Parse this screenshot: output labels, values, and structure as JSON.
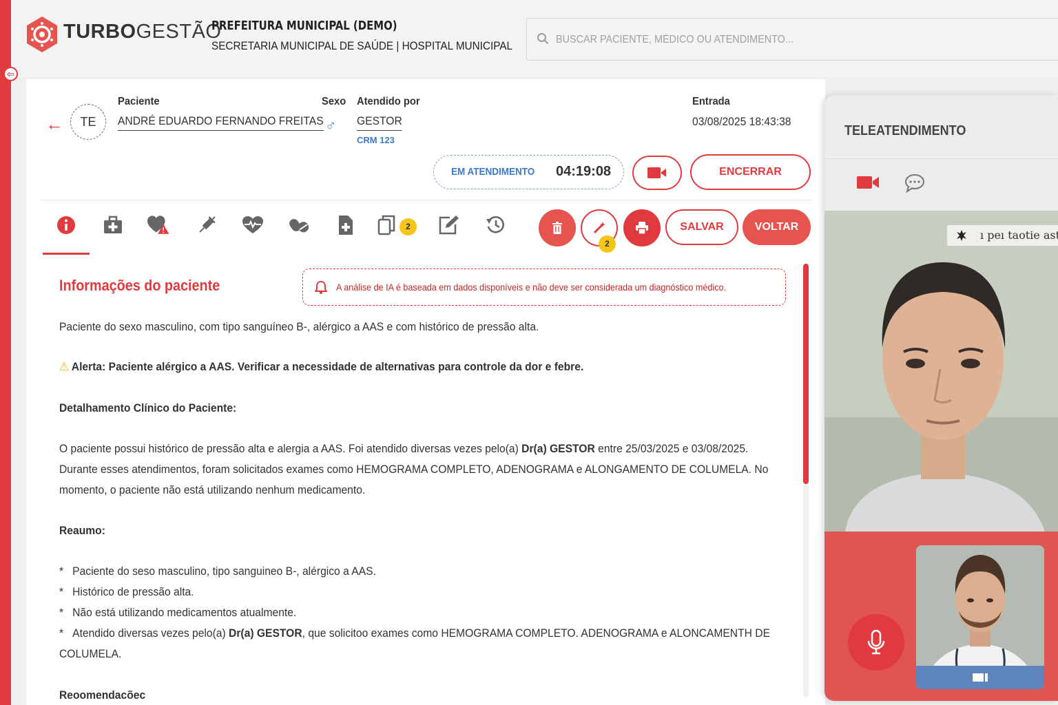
{
  "app": {
    "logo_bold": "TURBO",
    "logo_light": "GESTÃO",
    "org_title": "PREFEITURA MUNICIPAL (DEMO)",
    "org_subtitle": "SECRETARIA MUNICIPAL DE SAÚDE | HOSPITAL MUNICIPAL",
    "search_placeholder": "BUSCAR PACIENTE, MÉDICO OU ATENDIMENTO..."
  },
  "patient": {
    "avatar_initials": "TE",
    "patient_label": "Paciente",
    "patient_name": "ANDRÉ EDUARDO FERNANDO FREITAS",
    "sex_label": "Sexo",
    "attended_label": "Atendido por",
    "attended_by": "GESTOR",
    "crm": "CRM 123",
    "entry_label": "Entrada",
    "entry_value": "03/08/2025 18:43:38"
  },
  "status": {
    "label": "EM ATENDIMENTO",
    "timer": "04:19:08",
    "end_label": "ENCERRAR"
  },
  "toolbar": {
    "documents_badge": "2",
    "ai_badge": "2",
    "save_label": "SALVAR",
    "back_label": "VOLTAR"
  },
  "content": {
    "section_title": "Informações do paciente",
    "ai_notice": "A análise de IA é baseada em dados disponíveis e não deve ser considerada um diagnóstico médico.",
    "intro": "Paciente do sexo masculino, com tipo sanguíneo B-, alérgico a AAS e com histórico de pressão alta.",
    "alert": "Alerta: Paciente alérgico a AAS. Verificar a necessidade de alternativas para controle da dor e febre.",
    "detail_heading": "Detalhamento Clínico do Paciente:",
    "detail_line1_a": "O paciente possui histórico de pressão alta e alergia a AAS. Foi atendido diversas vezes pelo(a) ",
    "detail_line1_b": "Dr(a) GESTOR",
    "detail_line1_c": " entre 25/03/2025 e 03/08/2025.",
    "detail_line2": "Durante esses atendimentos, foram solicitados exames como HEMOGRAMA COMPLETO, ADENOGRAMA e ALONGAMENTO DE COLUMELA. No",
    "detail_line3": "momento, o paciente não está utilizando nenhum medicamento.",
    "summary_heading": "Reaumo:",
    "bullet1": "Paciente do seso masculino, tipo sanguineo B-, alérgico a AAS.",
    "bullet2": "Histórico de pressão alta.",
    "bullet3": "Não está utilizando medicamentos atualmente.",
    "bullet4_a": "Atendido diversas vezes pelo(a) ",
    "bullet4_b": "Dr(a) GESTOR",
    "bullet4_c": ", que solicitoo exames como HEMOGRAMA COMPLETO. ADENOGRAMA e ALONCAMENTH DE",
    "bullet4_d": "COLUMELA.",
    "bullet_marker": "*",
    "recommend_heading": "Reoomendacõec"
  },
  "tele": {
    "title": "TELEATENDIMENTO",
    "caption": "ı peı taotie astá"
  },
  "colors": {
    "accent": "#e03a3e",
    "info_blue": "#3b7ac9",
    "badge_yellow": "#f5c518"
  },
  "icons": [
    "info-icon",
    "medical-kit-icon",
    "heart-alert-icon",
    "syringe-icon",
    "heartbeat-icon",
    "pills-icon",
    "file-plus-icon",
    "documents-icon",
    "edit-icon",
    "history-icon",
    "trash-icon",
    "magic-wand-icon",
    "print-icon",
    "video-camera-icon",
    "chat-icon",
    "microphone-icon",
    "search-icon"
  ]
}
